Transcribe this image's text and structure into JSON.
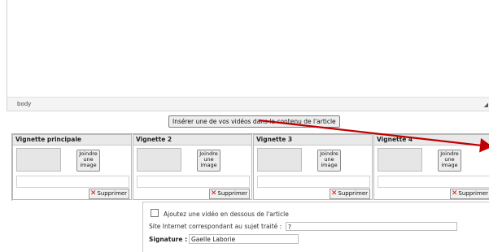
{
  "editor": {
    "path_label": "body",
    "resize_glyph": "◢"
  },
  "insert_button": {
    "label": "Insérer une de vos vidéos dans le contenu de l'article"
  },
  "thumbnails": [
    {
      "title": "Vignette principale",
      "attach_label": "Joindre une image",
      "delete_label": "Supprimer"
    },
    {
      "title": "Vignette 2",
      "attach_label": "Joindre une image",
      "delete_label": "Supprimer"
    },
    {
      "title": "Vignette 3",
      "attach_label": "Joindre une image",
      "delete_label": "Supprimer"
    },
    {
      "title": "Vignette 4",
      "attach_label": "Joindre une image",
      "delete_label": "Supprimer"
    }
  ],
  "form": {
    "video_checkbox_label": "Ajoutez une vidéo en dessous de l'article",
    "site_label": "Site Internet correspondant au sujet traité :",
    "site_value": "?",
    "signature_label": "Signature :",
    "signature_value": "Gaelle Laborie"
  },
  "annotation": {
    "arrow_color": "#c00000"
  }
}
